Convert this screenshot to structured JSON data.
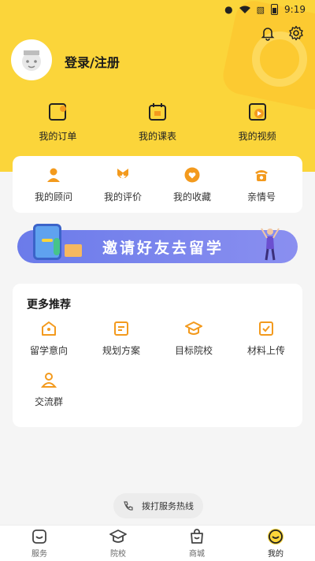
{
  "status_bar": {
    "time": "9:19"
  },
  "profile": {
    "login_label": "登录/注册"
  },
  "orders": [
    {
      "label": "我的订单",
      "icon": "order-icon"
    },
    {
      "label": "我的课表",
      "icon": "schedule-icon"
    },
    {
      "label": "我的视频",
      "icon": "video-icon"
    }
  ],
  "quick_links": [
    {
      "label": "我的顾问",
      "icon": "advisor-icon"
    },
    {
      "label": "我的评价",
      "icon": "rating-icon"
    },
    {
      "label": "我的收藏",
      "icon": "favorite-icon"
    },
    {
      "label": "亲情号",
      "icon": "phone-icon"
    }
  ],
  "banner": {
    "text": "邀请好友去留学"
  },
  "more": {
    "title": "更多推荐",
    "items": [
      {
        "label": "留学意向",
        "icon": "home-icon"
      },
      {
        "label": "规划方案",
        "icon": "plan-icon"
      },
      {
        "label": "目标院校",
        "icon": "graduation-cap-icon"
      },
      {
        "label": "材料上传",
        "icon": "upload-icon"
      },
      {
        "label": "交流群",
        "icon": "group-icon"
      }
    ]
  },
  "hotline": {
    "label": "拨打服务热线"
  },
  "tabs": [
    {
      "label": "服务",
      "icon": "service-icon"
    },
    {
      "label": "院校",
      "icon": "school-icon"
    },
    {
      "label": "商城",
      "icon": "shop-icon"
    },
    {
      "label": "我的",
      "icon": "profile-icon",
      "active": true
    }
  ],
  "colors": {
    "accent": "#fbd53a",
    "orange": "#f39a1d",
    "banner": "#7482ec"
  }
}
